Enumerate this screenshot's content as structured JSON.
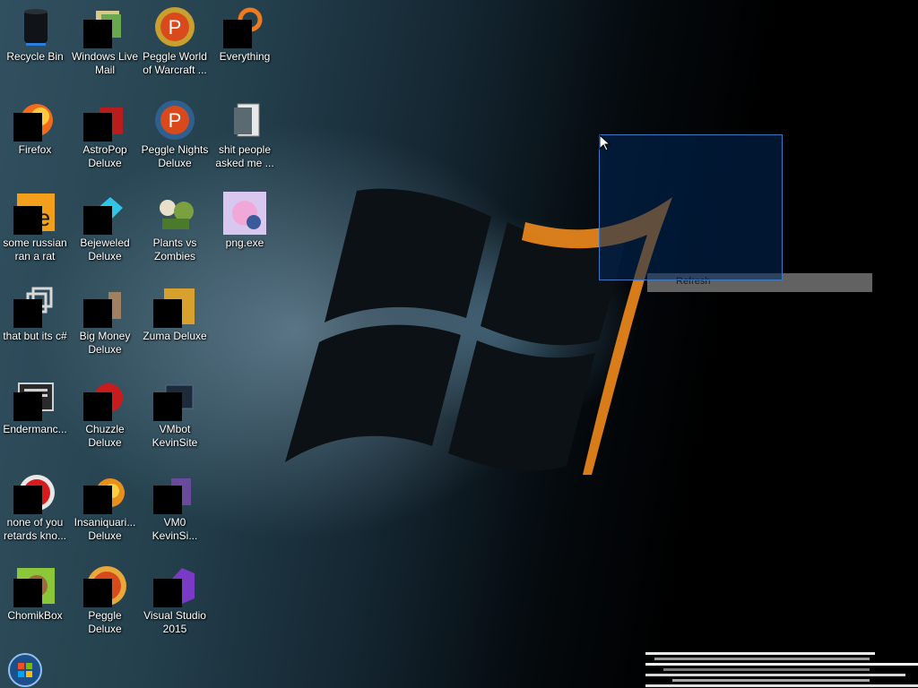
{
  "desktop_icons": [
    {
      "label": "Recycle Bin",
      "icon": "recycle-bin-icon"
    },
    {
      "label": "Windows Live\nMail",
      "icon": "windows-live-mail-icon"
    },
    {
      "label": "Peggle World\nof Warcraft ...",
      "icon": "peggle-world-of-warcraft-icon"
    },
    {
      "label": "Everything",
      "icon": "everything-search-icon"
    },
    {
      "label": "Firefox",
      "icon": "firefox-icon"
    },
    {
      "label": "AstroPop\nDeluxe",
      "icon": "astropop-deluxe-icon"
    },
    {
      "label": "Peggle Nights\nDeluxe",
      "icon": "peggle-nights-deluxe-icon"
    },
    {
      "label": "shit people\nasked me ...",
      "icon": "folder-icon"
    },
    {
      "label": "some russian\nran a rat",
      "icon": "some-russian-ran-a-rat-icon"
    },
    {
      "label": "Bejeweled\nDeluxe",
      "icon": "bejeweled-deluxe-icon"
    },
    {
      "label": "Plants vs\nZombies",
      "icon": "plants-vs-zombies-icon"
    },
    {
      "label": "png.exe",
      "icon": "png-exe-icon"
    },
    {
      "label": "that but its c#",
      "icon": "that-but-its-csharp-icon"
    },
    {
      "label": "Big Money\nDeluxe",
      "icon": "big-money-deluxe-icon"
    },
    {
      "label": "Zuma Deluxe",
      "icon": "zuma-deluxe-icon"
    },
    {
      "label": "Endermanc...",
      "icon": "endermanch-icon"
    },
    {
      "label": "Chuzzle\nDeluxe",
      "icon": "chuzzle-deluxe-icon"
    },
    {
      "label": "VMbot\nKevinSite",
      "icon": "vmbot-kevinsite-icon"
    },
    {
      "label": "none of you\nretards kno...",
      "icon": "none-of-you-icon"
    },
    {
      "label": "Insaniquari...\nDeluxe",
      "icon": "insaniquarium-deluxe-icon"
    },
    {
      "label": "VM0\nKevinSi...",
      "icon": "vm0-kevinsite-icon"
    },
    {
      "label": "ChomikBox",
      "icon": "chomikbox-icon"
    },
    {
      "label": "Peggle Deluxe",
      "icon": "peggle-deluxe-icon"
    },
    {
      "label": "Visual Studio\n2015",
      "icon": "visual-studio-2015-icon"
    }
  ],
  "context": {
    "refresh_label": "Refresh"
  },
  "taskbar": {
    "start_icon": "windows-start-orb-icon"
  },
  "colors": {
    "selection_fill": "#00285a",
    "selection_border": "#3e78c2",
    "logo_orange": "#f08a1c"
  }
}
